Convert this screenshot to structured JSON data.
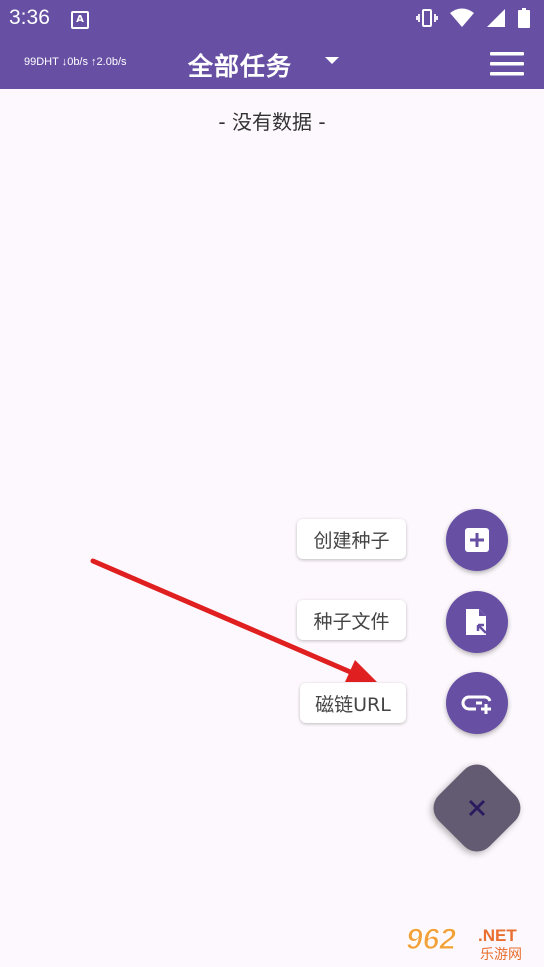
{
  "status_bar": {
    "time": "3:36",
    "notification_glyph": "A",
    "icons": [
      "vibrate-icon",
      "wifi-icon",
      "signal-icon",
      "battery-icon"
    ]
  },
  "app_bar": {
    "stats": "99DHT ↓0b/s ↑2.0b/s",
    "title": "全部任务",
    "dropdown_icon": "caret-down-icon",
    "menu_icon": "hamburger-menu-icon",
    "color": "#6750a4"
  },
  "content": {
    "empty_text": "- 没有数据 -"
  },
  "fab_menu": {
    "items": [
      {
        "label": "创建种子",
        "icon": "add-box-icon"
      },
      {
        "label": "种子文件",
        "icon": "file-open-icon"
      },
      {
        "label": "磁链URL",
        "icon": "add-link-icon"
      }
    ],
    "main_icon": "close-icon",
    "main_color": "#625b71"
  },
  "annotation": {
    "arrow_color": "#e02020"
  },
  "watermark": {
    "number": "962",
    "suffix": ".NET",
    "sub": "乐游网"
  }
}
